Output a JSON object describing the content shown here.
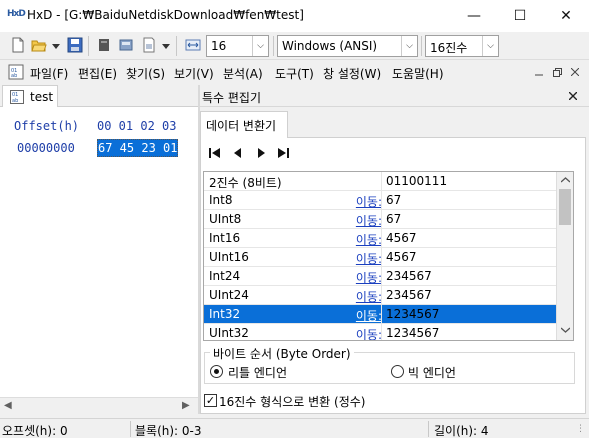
{
  "window": {
    "app_logo": "HxD",
    "title": "HxD - [G:₩BaiduNetdiskDownload₩fen₩test]",
    "minimize_glyph": "—",
    "maximize_glyph": "☐",
    "close_glyph": "✕"
  },
  "toolbar": {
    "bytes_per_row": "16",
    "charset": "Windows (ANSI)",
    "offset_base": "16진수"
  },
  "menu": {
    "items": [
      "파일(F)",
      "편집(E)",
      "찾기(S)",
      "보기(V)",
      "분석(A)",
      "도구(T)",
      "창 설정(W)",
      "도움말(H)"
    ]
  },
  "editor": {
    "tab_label": "test",
    "offset_header": "Offset(h)",
    "column_headers": "00 01 02 03",
    "rows": [
      {
        "offset": "00000000",
        "bytes": "67 45 23 01"
      }
    ]
  },
  "special_editor": {
    "title": "특수 편집기",
    "tab": "데이터 변환기",
    "move_label": "이동:",
    "rows": [
      {
        "name": "2진수 (8비트)",
        "value": "01100111",
        "has_move": false
      },
      {
        "name": "Int8",
        "value": "67",
        "has_move": true
      },
      {
        "name": "UInt8",
        "value": "67",
        "has_move": true
      },
      {
        "name": "Int16",
        "value": "4567",
        "has_move": true
      },
      {
        "name": "UInt16",
        "value": "4567",
        "has_move": true
      },
      {
        "name": "Int24",
        "value": "234567",
        "has_move": true
      },
      {
        "name": "UInt24",
        "value": "234567",
        "has_move": true
      },
      {
        "name": "Int32",
        "value": "1234567",
        "has_move": true,
        "selected": true
      },
      {
        "name": "UInt32",
        "value": "1234567",
        "has_move": true
      }
    ],
    "byte_order": {
      "title": "바이트 순서 (Byte Order)",
      "little": "리틀 엔디언",
      "big": "빅 엔디언",
      "selected": "little"
    },
    "hex_checkbox": {
      "label": "16진수 형식으로 변환 (정수)",
      "checked": true
    }
  },
  "status": {
    "offset": "오프셋(h): 0",
    "block": "블록(h): 0-3",
    "length": "길이(h): 4"
  },
  "colors": {
    "selection": "#0a6fd8",
    "offset_text": "#1e3ea8",
    "link": "#1a3fbf"
  }
}
